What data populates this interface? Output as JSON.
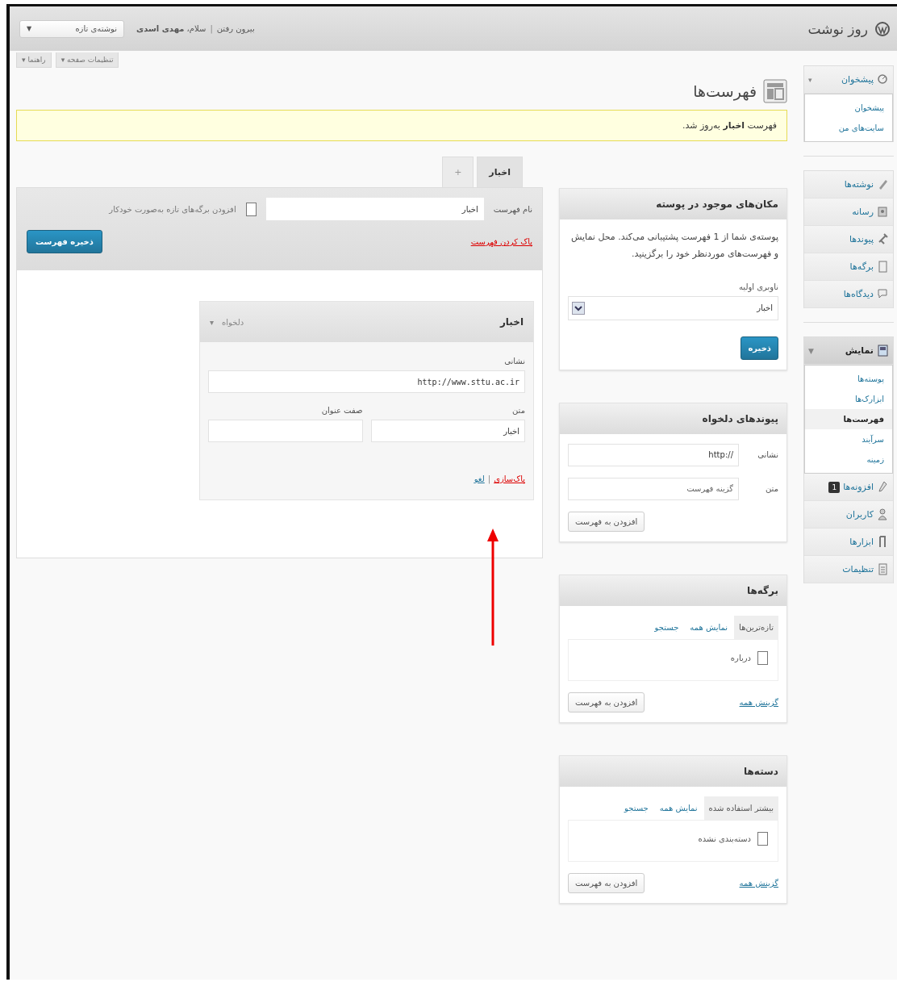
{
  "admin_bar": {
    "site_name": "روز نوشت",
    "new_post": "نوشته‌ی تازه",
    "new_post_arrow": "▼",
    "greeting": "سلام، **مهدی اسدی**",
    "divider": "|",
    "logout": "بیرون رفتن"
  },
  "screen_tabs": [
    {
      "label": "تنظیمات صفحه ▾"
    },
    {
      "label": "راهنما ▾"
    }
  ],
  "sidebar": {
    "items": [
      {
        "kind": "item",
        "label": "پیشخوان",
        "toggle": "▾",
        "selected": false,
        "expanded": true,
        "children": [
          {
            "label": "پیشخوان",
            "selected": false
          },
          {
            "label": "سایت‌های من",
            "selected": false
          }
        ]
      },
      {
        "kind": "separator"
      },
      {
        "kind": "item",
        "label": "نوشته‌ها",
        "selected": false
      },
      {
        "kind": "item",
        "label": "رسانه",
        "selected": false
      },
      {
        "kind": "item",
        "label": "پیوندها",
        "selected": false
      },
      {
        "kind": "item",
        "label": "برگه‌ها",
        "selected": false
      },
      {
        "kind": "item",
        "label": "دیدگاه‌ها",
        "selected": false
      },
      {
        "kind": "separator"
      },
      {
        "kind": "item",
        "label": "نمایش",
        "toggle": "▼",
        "selected": true,
        "expanded": true,
        "children": [
          {
            "label": "پوسته‌ها",
            "selected": false
          },
          {
            "label": "ابزارک‌ها",
            "selected": false
          },
          {
            "label": "فهرست‌ها",
            "selected": true
          },
          {
            "label": "سرآیند",
            "selected": false
          },
          {
            "label": "زمینه",
            "selected": false
          }
        ]
      },
      {
        "kind": "item",
        "label": "افزونه‌ها",
        "badge": "1",
        "selected": false
      },
      {
        "kind": "item",
        "label": "کاربران",
        "selected": false
      },
      {
        "kind": "item",
        "label": "ابزارها",
        "selected": false
      },
      {
        "kind": "item",
        "label": "تنظیمات",
        "selected": false
      }
    ]
  },
  "page_title": "فهرست‌ها",
  "notice": "فهرست **اخبار** به‌روز شد.",
  "menu_tabs": [
    {
      "label": "اخبار",
      "selected": true
    },
    {
      "label": "+",
      "selected": false
    }
  ],
  "menu_header": {
    "name_label": "نام فهرست",
    "name_value": "اخبار",
    "auto_add_label": "افزودن برگه‌های تازه به‌صورت خودکار",
    "auto_add_checked": false,
    "save_button": "ذخیره فهرست",
    "delete_link": "پاک کردن فهرست"
  },
  "menu_items": [
    {
      "title": "اخبار",
      "type": "دلخواه",
      "toggle": "▾",
      "expanded": true,
      "url_label": "نشانی",
      "url": "http://www.sttu.ac.ir",
      "text_label": "متن",
      "text_value": "اخبار",
      "attr_label": "صفت عنوان",
      "remove_link": "پاک‌سازی",
      "divider": "|",
      "cancel_link": "لغو"
    }
  ],
  "boxes": [
    {
      "kind": "locations",
      "title": "مکان‌های موجود در پوسته",
      "text": "پوسته‌ی شما از 1 فهرست پشتیبانی می‌کند. محل نمایش و فهرست‌های موردنظر خود را برگزینید.",
      "select_label": "ناوبری اولیه",
      "select_value": "اخبار",
      "button": "ذخیره"
    },
    {
      "kind": "custom_links",
      "title": "پیوندهای دلخواه",
      "url_label": "نشانی",
      "url_value": "http://",
      "text_label": "متن",
      "text_placeholder": "گزینه فهرست",
      "button": "افزودن به فهرست"
    },
    {
      "kind": "list",
      "title": "برگه‌ها",
      "tabs": [
        {
          "label": "تازه‌ترین‌ها",
          "selected": true
        },
        {
          "label": "نمایش همه",
          "selected": false
        },
        {
          "label": "جستجو",
          "selected": false
        }
      ],
      "options": [
        {
          "label": "درباره",
          "checked": false
        }
      ],
      "select_all": "گزینش همه",
      "button": "افزودن به فهرست"
    },
    {
      "kind": "list",
      "title": "دسته‌ها",
      "tabs": [
        {
          "label": "بیشتر استفاده شده",
          "selected": true
        },
        {
          "label": "نمایش همه",
          "selected": false
        },
        {
          "label": "جستجو",
          "selected": false
        }
      ],
      "options": [
        {
          "label": "دسته‌بندی نشده",
          "checked": false
        }
      ],
      "select_all": "گزینش همه",
      "button": "افزودن به فهرست"
    }
  ]
}
